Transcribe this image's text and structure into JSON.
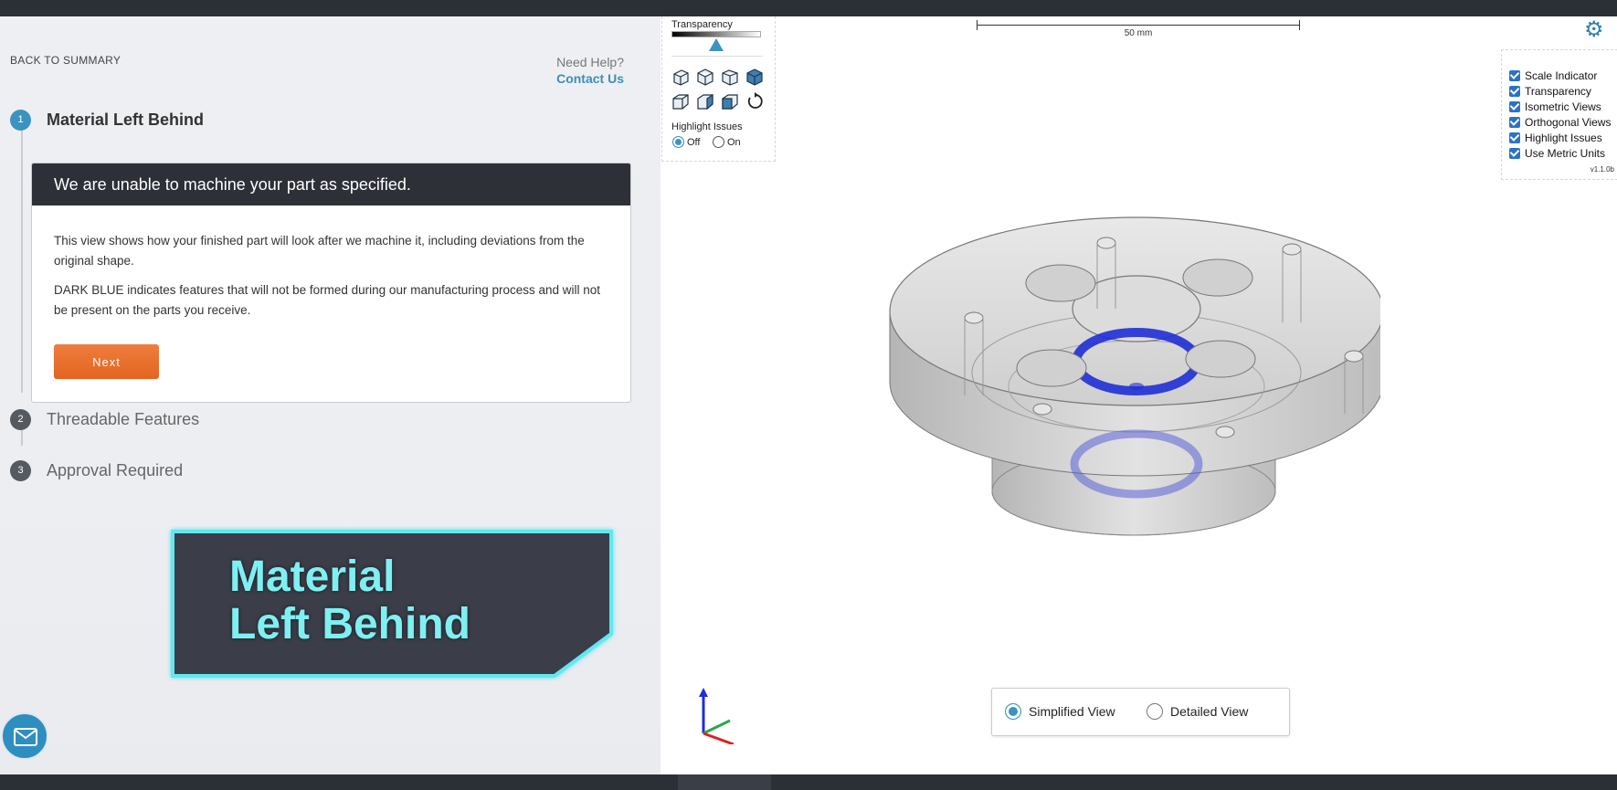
{
  "nav": {
    "back_label": "BACK TO SUMMARY",
    "help_question": "Need Help?",
    "help_link": "Contact Us"
  },
  "steps": [
    {
      "number": "1",
      "label": "Material Left Behind",
      "state": "active"
    },
    {
      "number": "2",
      "label": "Threadable Features",
      "state": "inactive"
    },
    {
      "number": "3",
      "label": "Approval Required",
      "state": "inactive"
    }
  ],
  "card": {
    "title": "We are unable to machine your part as specified.",
    "paragraph1": "This view shows how your finished part will look after we machine it, including deviations from the original shape.",
    "paragraph2": "DARK BLUE indicates features that will not be formed during our manufacturing process and will not be present on the parts you receive.",
    "next_label": "Next"
  },
  "banner": {
    "line1": "Material",
    "line2": "Left Behind"
  },
  "viewer": {
    "transparency_label": "Transparency",
    "transparency_level": 0.5,
    "view_icons": [
      "iso-view-1-icon",
      "iso-view-2-icon",
      "iso-view-3-icon",
      "iso-view-4-icon",
      "ortho-view-1-icon",
      "ortho-view-2-icon",
      "ortho-view-3-icon",
      "reset-view-icon"
    ],
    "highlight_label": "Highlight Issues",
    "highlight_off": "Off",
    "highlight_on": "On",
    "highlight_selected": "Off",
    "scale_label": "50 mm",
    "options": [
      {
        "label": "Scale Indicator",
        "checked": true
      },
      {
        "label": "Transparency",
        "checked": true
      },
      {
        "label": "Isometric Views",
        "checked": true
      },
      {
        "label": "Orthogonal Views",
        "checked": true
      },
      {
        "label": "Highlight Issues",
        "checked": true
      },
      {
        "label": "Use Metric Units",
        "checked": true
      }
    ],
    "version": "v1.1.0b",
    "view_modes": {
      "simplified": "Simplified View",
      "detailed": "Detailed View",
      "selected": "Simplified View"
    }
  },
  "colors": {
    "accent": "#3b93bf",
    "next_button": "#e8702d",
    "card_header": "#2d3036",
    "banner_glow": "#5ee8f0",
    "issue_blue": "#1f2fd6"
  }
}
